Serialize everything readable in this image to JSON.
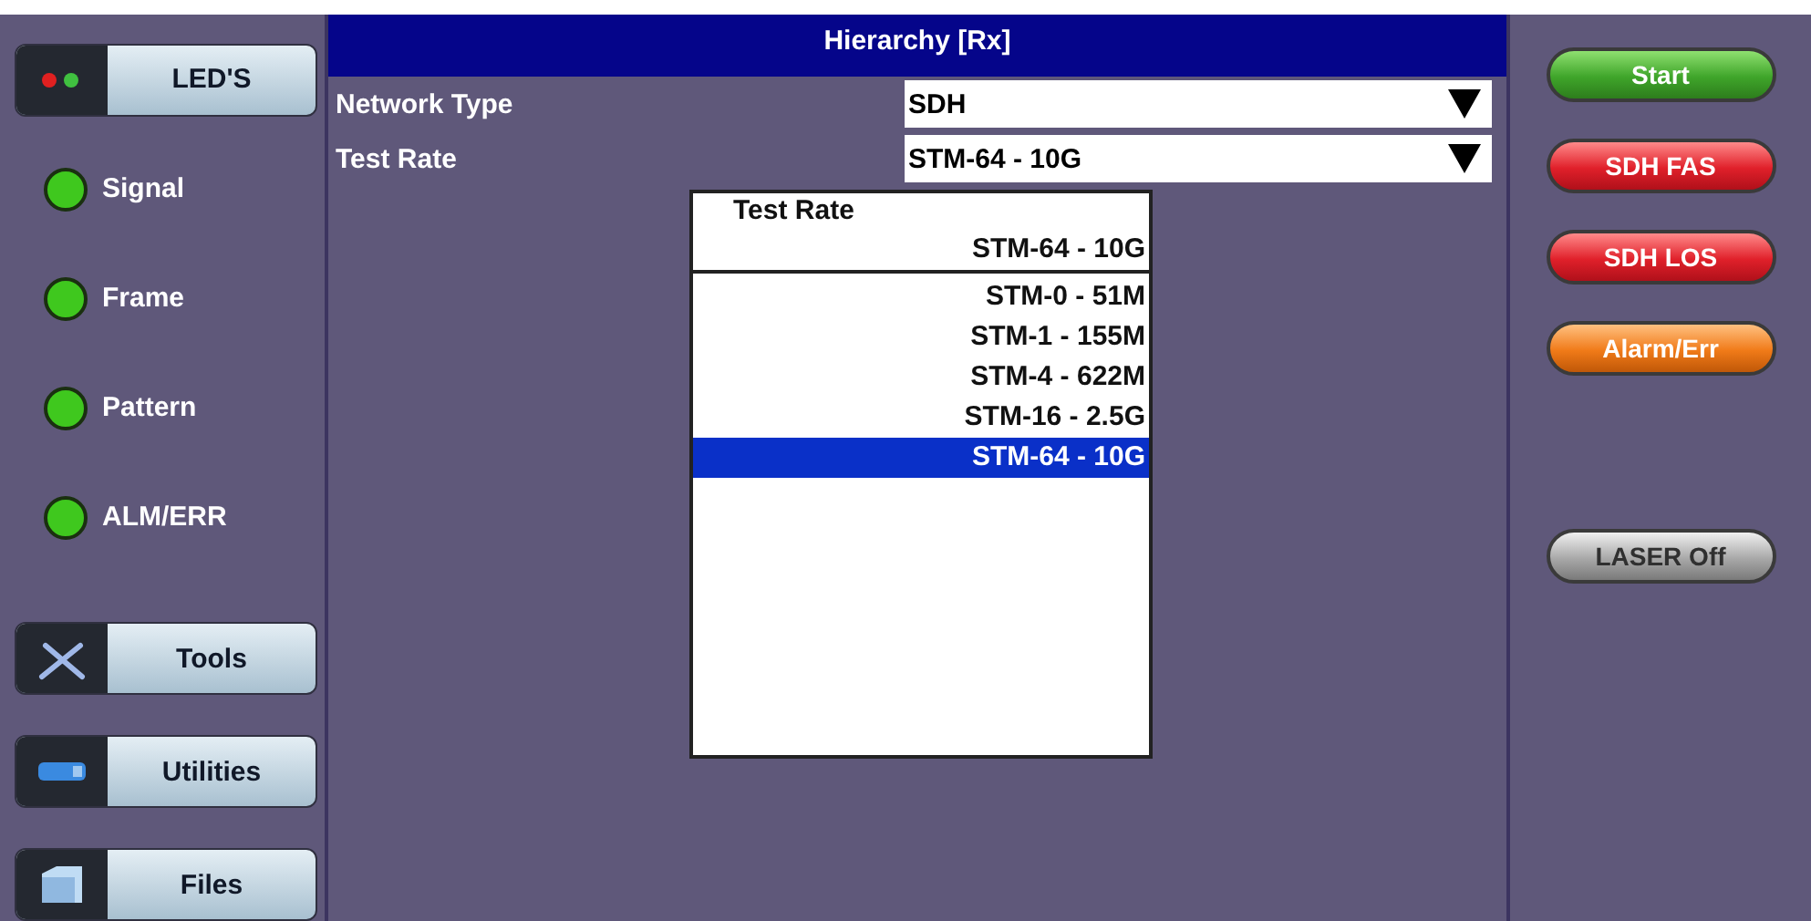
{
  "sidebar": {
    "leds_button": "LED'S",
    "leds": [
      {
        "label": "Signal",
        "color": "#3fc81e"
      },
      {
        "label": "Frame",
        "color": "#3fc81e"
      },
      {
        "label": "Pattern",
        "color": "#3fc81e"
      },
      {
        "label": "ALM/ERR",
        "color": "#3fc81e"
      }
    ],
    "nav": [
      {
        "label": "Tools",
        "kind": "tools"
      },
      {
        "label": "Utilities",
        "kind": "utilities"
      },
      {
        "label": "Files",
        "kind": "files"
      }
    ]
  },
  "panel": {
    "title": "Hierarchy [Rx]",
    "fields": [
      {
        "label": "Network Type",
        "value": "SDH"
      },
      {
        "label": "Test Rate",
        "value": "STM-64 - 10G"
      }
    ]
  },
  "popup": {
    "title": "Test Rate",
    "current": "STM-64 - 10G",
    "options": [
      {
        "label": "STM-0 - 51M",
        "selected": false
      },
      {
        "label": "STM-1 - 155M",
        "selected": false
      },
      {
        "label": "STM-4 - 622M",
        "selected": false
      },
      {
        "label": "STM-16 - 2.5G",
        "selected": false
      },
      {
        "label": "STM-64 - 10G",
        "selected": true
      }
    ]
  },
  "actions": [
    {
      "label": "Start",
      "kind": "green"
    },
    {
      "label": "SDH FAS",
      "kind": "red"
    },
    {
      "label": "SDH LOS",
      "kind": "red"
    },
    {
      "label": "Alarm/Err",
      "kind": "orange"
    },
    {
      "label": "LASER Off",
      "kind": "grey"
    }
  ]
}
